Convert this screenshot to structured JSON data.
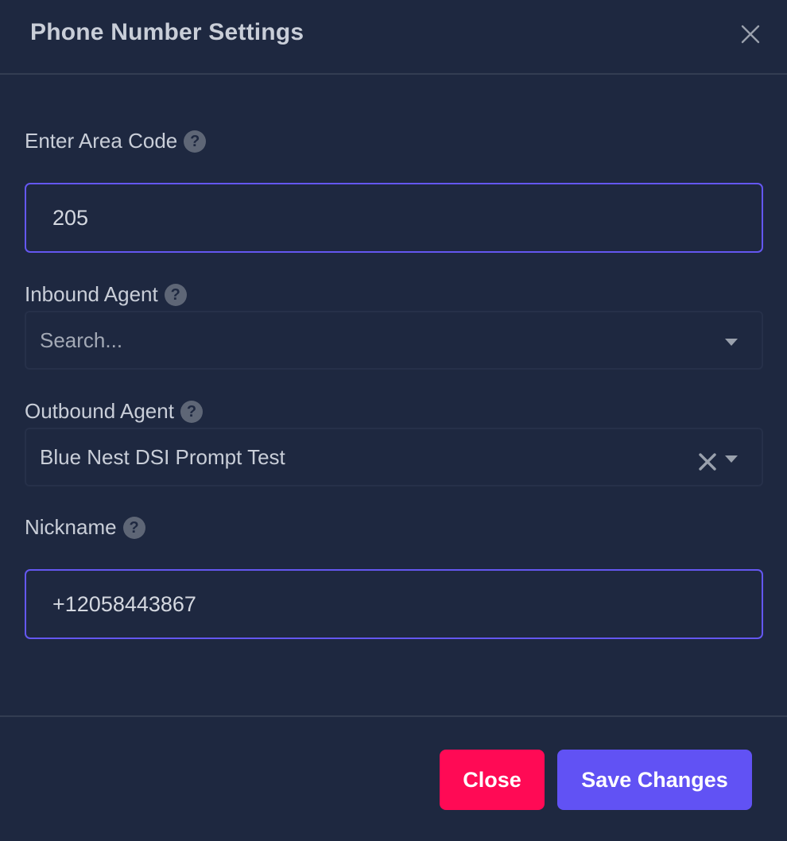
{
  "modal": {
    "title": "Phone Number Settings"
  },
  "fields": {
    "area_code": {
      "label": "Enter Area Code",
      "value": "205"
    },
    "inbound_agent": {
      "label": "Inbound Agent",
      "placeholder": "Search..."
    },
    "outbound_agent": {
      "label": "Outbound Agent",
      "value": "Blue Nest DSI Prompt Test"
    },
    "nickname": {
      "label": "Nickname",
      "value": "+12058443867"
    }
  },
  "help_glyph": "?",
  "footer": {
    "close_label": "Close",
    "save_label": "Save Changes"
  },
  "icons": {
    "dialog_close": "close-icon",
    "help": "help-circle-icon",
    "dropdown": "chevron-down-icon",
    "clear": "clear-icon"
  },
  "colors": {
    "background": "#1e2840",
    "accent": "#6152f4",
    "danger": "#ff0a55",
    "text": "#c9ced8"
  }
}
